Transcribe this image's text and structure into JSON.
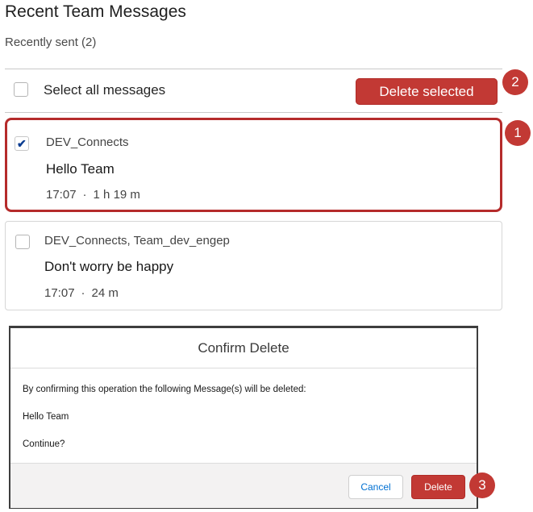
{
  "header": {
    "title": "Recent Team Messages",
    "subtitle": "Recently sent (2)"
  },
  "toolbar": {
    "select_all_label": "Select all messages",
    "delete_selected_label": "Delete selected"
  },
  "messages": [
    {
      "checked": true,
      "sender": "DEV_Connects",
      "text": "Hello Team",
      "time": "17:07",
      "separator": "·",
      "age": "1 h 19 m"
    },
    {
      "checked": false,
      "sender": "DEV_Connects, Team_dev_engep",
      "text": "Don't worry be happy",
      "time": "17:07",
      "separator": "·",
      "age": "24 m"
    }
  ],
  "dialog": {
    "title": "Confirm Delete",
    "line1": "By confirming this operation the following Message(s) will be deleted:",
    "line2": "Hello Team",
    "line3": "Continue?",
    "cancel_label": "Cancel",
    "delete_label": "Delete"
  },
  "annotations": {
    "badge1": "1",
    "badge2": "2",
    "badge3": "3",
    "color": "#c23934"
  },
  "icons": {
    "check": "✔"
  }
}
